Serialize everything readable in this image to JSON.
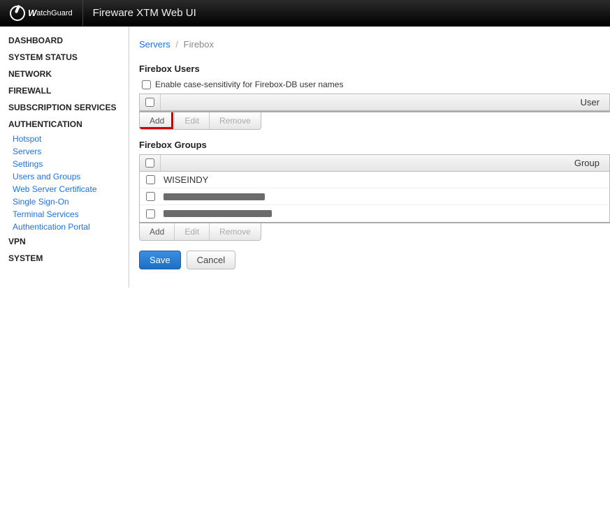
{
  "header": {
    "brand_first": "W",
    "brand_rest": "atchGuard",
    "product": "Fireware XTM Web UI"
  },
  "sidebar": {
    "sections": [
      {
        "label": "DASHBOARD",
        "sub": []
      },
      {
        "label": "SYSTEM STATUS",
        "sub": []
      },
      {
        "label": "NETWORK",
        "sub": []
      },
      {
        "label": "FIREWALL",
        "sub": []
      },
      {
        "label": "SUBSCRIPTION SERVICES",
        "sub": []
      },
      {
        "label": "AUTHENTICATION",
        "sub": [
          "Hotspot",
          "Servers",
          "Settings",
          "Users and Groups",
          "Web Server Certificate",
          "Single Sign-On",
          "Terminal Services",
          "Authentication Portal"
        ]
      },
      {
        "label": "VPN",
        "sub": []
      },
      {
        "label": "SYSTEM",
        "sub": []
      }
    ]
  },
  "breadcrumb": {
    "parent": "Servers",
    "current": "Firebox"
  },
  "users_panel": {
    "title": "Firebox Users",
    "case_label": "Enable case-sensitivity for Firebox-DB user names",
    "column": "User",
    "rows": [],
    "buttons": {
      "add": "Add",
      "edit": "Edit",
      "remove": "Remove"
    }
  },
  "groups_panel": {
    "title": "Firebox Groups",
    "column": "Group",
    "rows": [
      {
        "label": "WISEINDY",
        "redacted": false
      },
      {
        "label": "",
        "redacted": true,
        "w": 145
      },
      {
        "label": "",
        "redacted": true,
        "w": 155
      }
    ],
    "buttons": {
      "add": "Add",
      "edit": "Edit",
      "remove": "Remove"
    }
  },
  "actions": {
    "save": "Save",
    "cancel": "Cancel"
  }
}
